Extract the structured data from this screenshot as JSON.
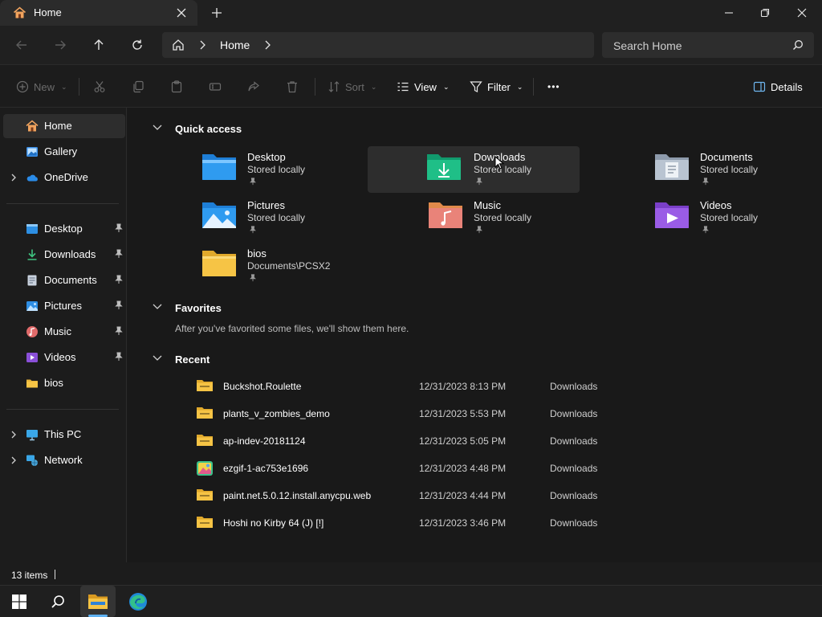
{
  "window": {
    "tab_title": "Home",
    "new_tab_symbol": "+",
    "breadcrumb": [
      "Home"
    ],
    "search_placeholder": "Search Home"
  },
  "commands": {
    "new": "New",
    "sort": "Sort",
    "view": "View",
    "filter": "Filter",
    "more": "•••",
    "details": "Details"
  },
  "sidebar": {
    "top": [
      {
        "label": "Home",
        "icon": "home-icon",
        "selected": true
      },
      {
        "label": "Gallery",
        "icon": "gallery-icon"
      },
      {
        "label": "OneDrive",
        "icon": "onedrive-icon",
        "expandable": true
      }
    ],
    "pinned": [
      {
        "label": "Desktop",
        "icon": "desktop-icon"
      },
      {
        "label": "Downloads",
        "icon": "downloads-icon"
      },
      {
        "label": "Documents",
        "icon": "documents-icon"
      },
      {
        "label": "Pictures",
        "icon": "pictures-icon"
      },
      {
        "label": "Music",
        "icon": "music-icon"
      },
      {
        "label": "Videos",
        "icon": "videos-icon"
      },
      {
        "label": "bios",
        "icon": "folder-icon"
      }
    ],
    "bottom": [
      {
        "label": "This PC",
        "icon": "pc-icon"
      },
      {
        "label": "Network",
        "icon": "network-icon"
      }
    ]
  },
  "quick_access": {
    "title": "Quick access",
    "items": [
      {
        "name": "Desktop",
        "sub": "Stored locally",
        "icon": "desktop-folder-icon"
      },
      {
        "name": "Downloads",
        "sub": "Stored locally",
        "icon": "downloads-folder-icon"
      },
      {
        "name": "Documents",
        "sub": "Stored locally",
        "icon": "documents-folder-icon"
      },
      {
        "name": "Pictures",
        "sub": "Stored locally",
        "icon": "pictures-folder-icon"
      },
      {
        "name": "Music",
        "sub": "Stored locally",
        "icon": "music-folder-icon"
      },
      {
        "name": "Videos",
        "sub": "Stored locally",
        "icon": "videos-folder-icon"
      },
      {
        "name": "bios",
        "sub": "Documents\\PCSX2",
        "icon": "folder-icon"
      }
    ]
  },
  "favorites": {
    "title": "Favorites",
    "empty_message": "After you've favorited some files, we'll show them here."
  },
  "recent": {
    "title": "Recent",
    "rows": [
      {
        "name": "Buckshot.Roulette",
        "date": "12/31/2023 8:13 PM",
        "location": "Downloads",
        "icon": "zip-folder-icon"
      },
      {
        "name": "plants_v_zombies_demo",
        "date": "12/31/2023 5:53 PM",
        "location": "Downloads",
        "icon": "zip-folder-icon"
      },
      {
        "name": "ap-indev-20181124",
        "date": "12/31/2023 5:05 PM",
        "location": "Downloads",
        "icon": "zip-folder-icon"
      },
      {
        "name": "ezgif-1-ac753e1696",
        "date": "12/31/2023 4:48 PM",
        "location": "Downloads",
        "icon": "image-file-icon"
      },
      {
        "name": "paint.net.5.0.12.install.anycpu.web",
        "date": "12/31/2023 4:44 PM",
        "location": "Downloads",
        "icon": "zip-folder-icon"
      },
      {
        "name": "Hoshi no Kirby 64 (J) [!]",
        "date": "12/31/2023 3:46 PM",
        "location": "Downloads",
        "icon": "zip-folder-icon"
      }
    ]
  },
  "status": {
    "item_count": "13 items"
  },
  "colors": {
    "accent": "#5fb2f2",
    "folder": "#f6c445",
    "window_bg": "#191919"
  }
}
